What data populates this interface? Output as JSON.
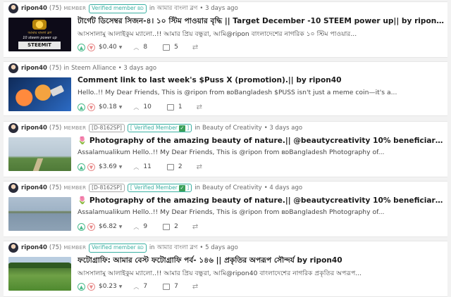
{
  "posts": [
    {
      "author": "ripon40",
      "rep": "(75)",
      "role": "MEMBER",
      "badge": "Verified member",
      "badge_suffix": "BD",
      "in_label": "in",
      "community": "আমার বাংলা ব্লগ",
      "time": "• 3 days ago",
      "title": "টার্গেট ডিসেম্বর সিজন-৪। ১০ স্টিম পাওয়ার বৃদ্ধি || Target December -10 STEEM power up|| by ripon40",
      "summary": "আসসালামু আলাইকুম ম্যালো..!! আমার প্রিয় বন্ধুরা, আমি@ripon বাংলাদেশের নাগরিক ১০ স্টিম পাওয়ার...",
      "payout": "$0.40",
      "votes": "8",
      "comments": "5",
      "thumb_text": [
        "আমার বাংলা ব্লগ",
        "10 steem power up",
        "STEEMIT"
      ]
    },
    {
      "author": "ripon40",
      "rep": "(75)",
      "in_label": "in",
      "community": "Steem Alliance",
      "time": "• 3 days ago",
      "title": "Comment link to last week's $Puss X (promotion).|| by ripon40",
      "summary": "Hello..!! My Dear Friends, This is @ripon from ʙᴅBangladesh $PUSS isn't just a meme coin—it's a...",
      "payout": "$0.18",
      "votes": "10",
      "comments": "1"
    },
    {
      "author": "ripon40",
      "rep": "(75)",
      "role": "MEMBER",
      "tag": "[D-8162SP]",
      "badge": "[ Verified Member",
      "badge_close": "]",
      "in_label": "in",
      "community": "Beauty of Creativity",
      "time": "• 3 days ago",
      "title": "🌷 Photography of the amazing beauty of nature.|| @beautycreativity 10% beneficiary by ripon40",
      "summary": "Assalamualikum Hello..!! My Dear Friends, This is @ripon from ʙᴅBangladesh Photography of...",
      "payout": "$3.69",
      "votes": "11",
      "comments": "2"
    },
    {
      "author": "ripon40",
      "rep": "(75)",
      "role": "MEMBER",
      "tag": "[D-8162SP]",
      "badge": "[ Verified Member",
      "badge_close": "]",
      "in_label": "in",
      "community": "Beauty of Creativity",
      "time": "• 4 days ago",
      "title": "🌷 Photography of the amazing beauty of nature.|| @beautycreativity 10% beneficiary by ripon40",
      "summary": "Assalamualikum Hello..!! My Dear Friends, This is @ripon from ʙᴅBangladesh Photography of...",
      "payout": "$6.82",
      "votes": "9",
      "comments": "2"
    },
    {
      "author": "ripon40",
      "rep": "(75)",
      "role": "MEMBER",
      "badge": "Verified member",
      "badge_suffix": "BD",
      "in_label": "in",
      "community": "আমার বাংলা ব্লগ",
      "time": "• 5 days ago",
      "title": "ফটোগ্রাফি: আমার বেস্ট ফটোগ্রাফি পর্ব- ১৪৬ || প্রকৃতির অপরূপ সৌন্দর্য by ripon40",
      "summary": "আসসালামু আলাইকুম ম্যালো..!! আমার প্রিয় বন্ধুরা, আমি@ripon40 বাংলাদেশের নাগরিক প্রকৃতির অপরূপ...",
      "payout": "$0.23",
      "votes": "7",
      "comments": "7"
    }
  ],
  "icons": {
    "upvote": "chevron-up-icon",
    "downvote": "chevron-down-icon",
    "votes": "upvote-count-icon",
    "comments": "comment-icon",
    "resteem": "resteem-icon"
  },
  "colors": {
    "upvote": "#4aba8b",
    "downvote": "#e88a8a",
    "badge": "#3ab0a2",
    "verified_check": "#3aa05a"
  }
}
